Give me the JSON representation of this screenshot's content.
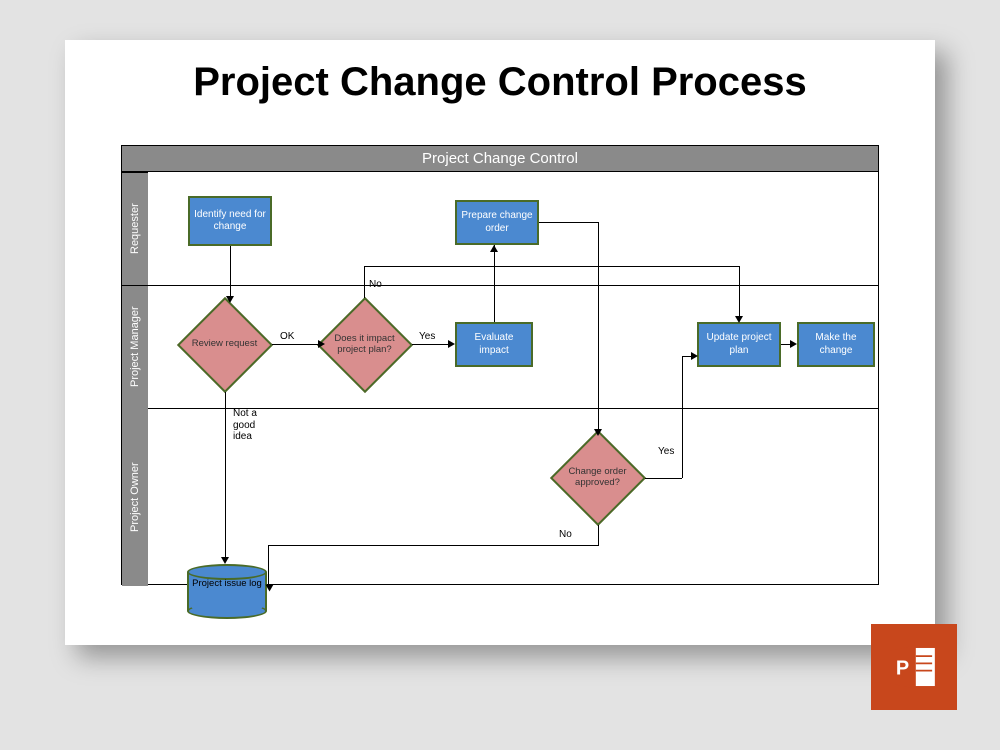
{
  "title": "Project Change Control Process",
  "swimlane": {
    "header": "Project Change Control",
    "lanes": {
      "requester": "Requester",
      "project_manager": "Project Manager",
      "project_owner": "Project Owner"
    }
  },
  "nodes": {
    "identify": "Identify need for change",
    "review": "Review request",
    "impact_q": "Does it impact project plan?",
    "evaluate": "Evaluate impact",
    "prepare": "Prepare change order",
    "approved_q": "Change order approved?",
    "update": "Update project plan",
    "make": "Make the change",
    "log": "Project issue log"
  },
  "edges": {
    "ok": "OK",
    "not_good": "Not a good idea",
    "yes1": "Yes",
    "no1": "No",
    "yes2": "Yes",
    "no2": "No"
  },
  "badge": "PowerPoint"
}
